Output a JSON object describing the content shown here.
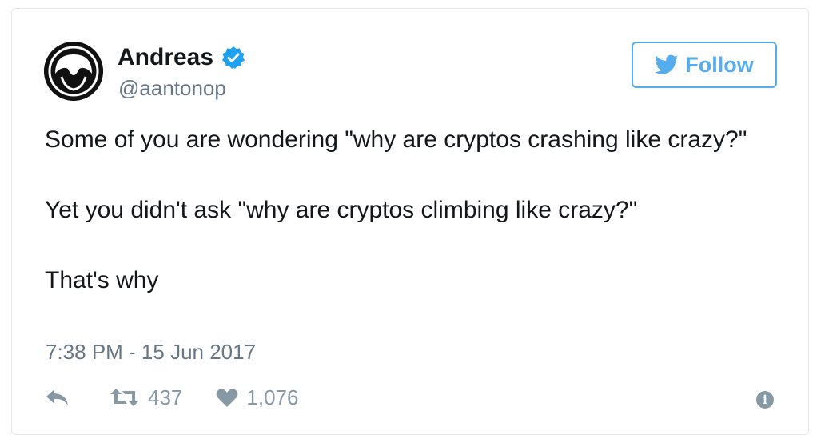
{
  "user": {
    "display_name": "Andreas",
    "handle": "@aantonop",
    "verified": true
  },
  "follow_button": {
    "label": "Follow"
  },
  "tweet": {
    "paragraphs": [
      "Some of you are wondering \"why are cryptos crashing like crazy?\"",
      "Yet you didn't ask \"why are cryptos climbing like crazy?\"",
      "That's why"
    ],
    "timestamp": "7:38 PM - 15 Jun 2017"
  },
  "actions": {
    "retweet_count": "437",
    "like_count": "1,076"
  },
  "icons": {
    "reply": "reply-icon",
    "retweet": "retweet-icon",
    "like": "heart-icon",
    "info": "info-icon",
    "verified": "verified-badge-icon",
    "twitter": "twitter-bird-icon"
  },
  "colors": {
    "accent": "#55acee",
    "text": "#14171a",
    "secondary": "#657786",
    "action": "#8899a6",
    "verified": "#1da1f2"
  }
}
